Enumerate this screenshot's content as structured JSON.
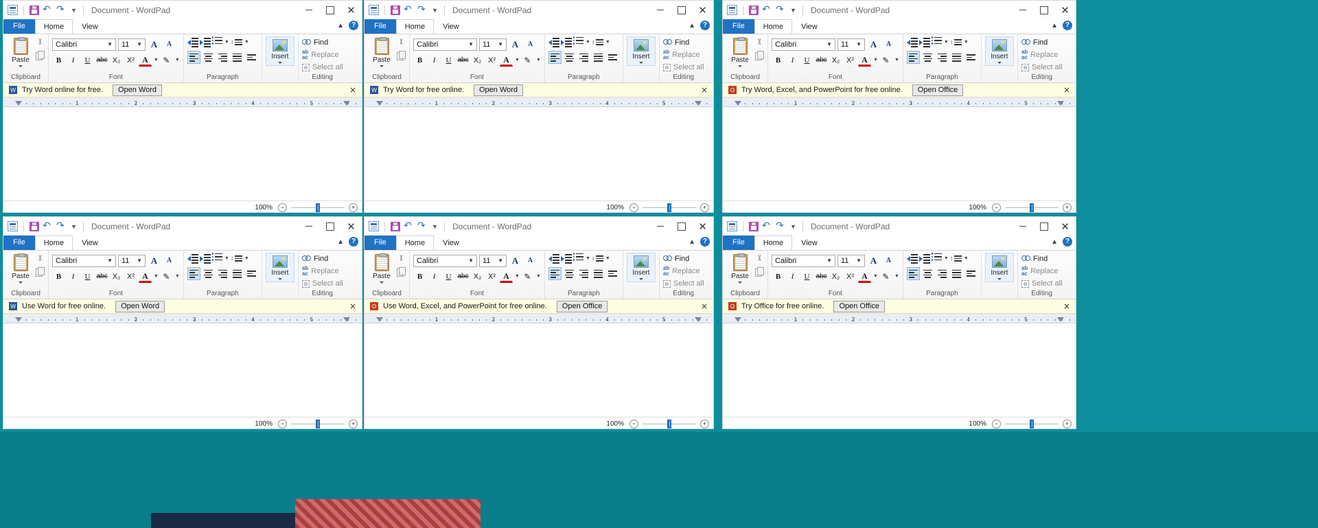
{
  "desktop": {
    "background_color": "#0d8e9c"
  },
  "window_common": {
    "title": "Document - WordPad",
    "quick_access": {
      "app_icon": "wordpad-icon",
      "save_icon": "save-icon",
      "undo_icon": "undo-icon",
      "redo_icon": "redo-icon",
      "customize_icon": "chevron-down-icon"
    },
    "window_controls": {
      "minimize": "minimize-icon",
      "maximize": "maximize-icon",
      "close": "close-icon"
    },
    "tabs": [
      {
        "label": "File",
        "active": false,
        "style": "file"
      },
      {
        "label": "Home",
        "active": true,
        "style": "normal"
      },
      {
        "label": "View",
        "active": false,
        "style": "normal"
      }
    ],
    "ribbon_collapse_icon": "chevron-up-icon",
    "help_icon": "help-icon",
    "groups": [
      {
        "name": "Clipboard",
        "label": "Clipboard",
        "paste_label": "Paste",
        "items": [
          "paste-icon",
          "cut-icon",
          "copy-icon"
        ]
      },
      {
        "name": "Font",
        "label": "Font",
        "font_family": "Calibri",
        "font_size": "11",
        "grow_font": "A",
        "shrink_font": "A",
        "bold": "B",
        "italic": "I",
        "underline": "U",
        "strikethrough": "abc",
        "subscript": "X₂",
        "superscript": "X²",
        "text_color": "A",
        "text_color_swatch": "#cc0000",
        "highlight": "highlight-icon"
      },
      {
        "name": "Paragraph",
        "label": "Paragraph",
        "items": [
          "decrease-indent-icon",
          "increase-indent-icon",
          "bullets-icon",
          "line-spacing-icon",
          "align-left-icon",
          "align-center-icon",
          "align-right-icon",
          "justify-icon",
          "paragraph-settings-icon"
        ]
      },
      {
        "name": "Insert",
        "label": "Insert",
        "insert_label": "Insert"
      },
      {
        "name": "Editing",
        "label": "Editing",
        "find_label": "Find",
        "replace_label": "Replace",
        "select_all_label": "Select all"
      }
    ],
    "ruler": {
      "numbers": [
        "1",
        "2",
        "3",
        "4",
        "5"
      ]
    },
    "statusbar": {
      "zoom_level": "100%",
      "zoom_out": "−",
      "zoom_in": "+"
    }
  },
  "windows": [
    {
      "id": "win-1",
      "banner": {
        "icon": "word-icon",
        "text": "Try Word online for free.",
        "button": "Open Word",
        "close": "×"
      }
    },
    {
      "id": "win-2",
      "banner": {
        "icon": "word-icon",
        "text": "Try Word for free online.",
        "button": "Open Word",
        "close": "×"
      }
    },
    {
      "id": "win-3",
      "banner": {
        "icon": "office-icon",
        "text": "Try Word, Excel, and PowerPoint for free online.",
        "button": "Open Office",
        "close": "×"
      }
    },
    {
      "id": "win-4",
      "banner": {
        "icon": "word-icon",
        "text": "Use Word for free online.",
        "button": "Open Word",
        "close": "×"
      }
    },
    {
      "id": "win-5",
      "banner": {
        "icon": "office-icon",
        "text": "Use Word, Excel, and PowerPoint for free online.",
        "button": "Open Office",
        "close": "×"
      }
    },
    {
      "id": "win-6",
      "banner": {
        "icon": "office-icon",
        "text": "Try Office for free online.",
        "button": "Open Office",
        "close": "×"
      }
    }
  ]
}
